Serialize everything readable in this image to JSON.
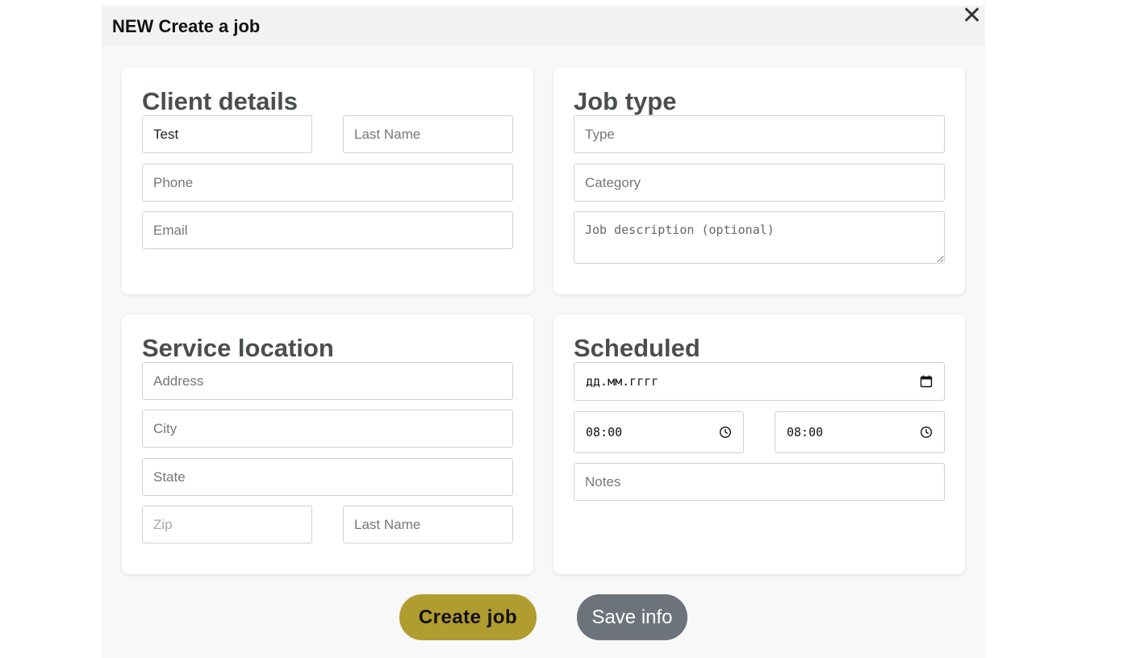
{
  "modal": {
    "title": "NEW Create a job",
    "close_symbol": "✕"
  },
  "client_details": {
    "title": "Client details",
    "first_name_value": "Test",
    "last_name_placeholder": "Last Name",
    "phone_placeholder": "Phone",
    "email_placeholder": "Email"
  },
  "job_type": {
    "title": "Job type",
    "type_placeholder": "Type",
    "category_placeholder": "Category",
    "description_placeholder": "Job description (optional)"
  },
  "service_location": {
    "title": "Service location",
    "address_placeholder": "Address",
    "city_placeholder": "City",
    "state_placeholder": "State",
    "zip_placeholder": "Zip",
    "last_name_placeholder": "Last Name"
  },
  "scheduled": {
    "title": "Scheduled",
    "date_value": "дд.мм.гггг",
    "start_time_value": "08:00",
    "end_time_value": "08:00",
    "notes_placeholder": "Notes",
    "icons": {
      "date": "calendar-icon",
      "time": "clock-icon"
    }
  },
  "actions": {
    "create_label": "Create job",
    "save_label": "Save info"
  },
  "colors": {
    "create_button": "#b09c2f",
    "save_button": "#6c737b",
    "card_title": "#4a4f4c",
    "modal_background": "#f8f8f9"
  }
}
